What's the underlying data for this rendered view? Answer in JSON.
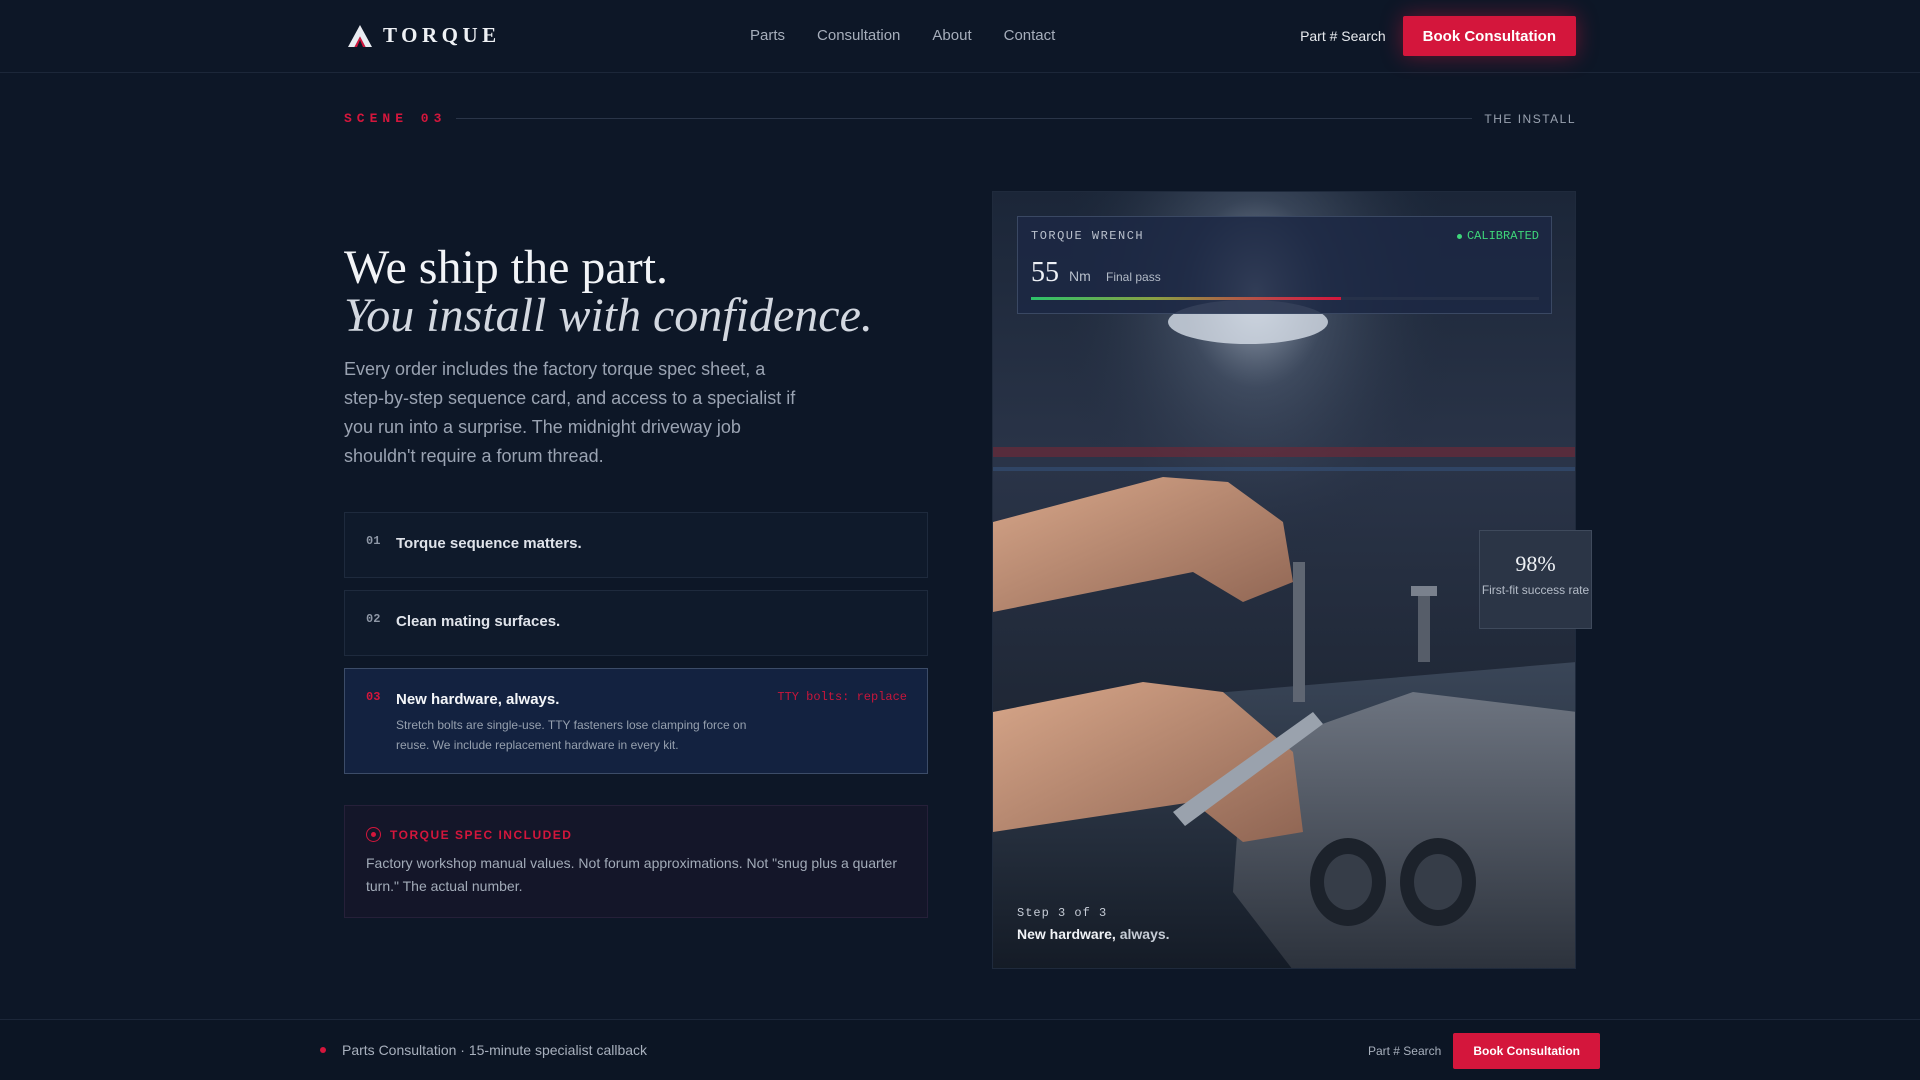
{
  "header": {
    "brand_name": "TORQUE",
    "brand_logo_icon": "triangle-a-logo-icon",
    "nav": [
      {
        "label": "Parts"
      },
      {
        "label": "Consultation"
      },
      {
        "label": "About"
      },
      {
        "label": "Contact"
      }
    ],
    "part_search": "Part # Search",
    "cta": "Book Consultation"
  },
  "scene": {
    "label": "SCENE 03",
    "title": "THE INSTALL"
  },
  "hero": {
    "line1": "We ship the part.",
    "line2": "You install with confidence.",
    "intro": "Every order includes the factory torque spec sheet, a step-by-step sequence card, and access to a specialist if you run into a surprise. The midnight driveway job shouldn't require a forum thread."
  },
  "steps": [
    {
      "num": "01",
      "title": "Torque sequence matters.",
      "desc": "",
      "tag": ""
    },
    {
      "num": "02",
      "title": "Clean mating surfaces.",
      "desc": "",
      "tag": ""
    },
    {
      "num": "03",
      "title": "New hardware, always.",
      "desc": "Stretch bolts are single-use. TTY fasteners lose clamping force on reuse. We include replacement hardware in every kit.",
      "tag": "TTY bolts: replace"
    }
  ],
  "spec_box": {
    "title": "TORQUE SPEC INCLUDED",
    "text": "Factory workshop manual values. Not forum approximations. Not \"snug plus a quarter turn.\" The actual number."
  },
  "wrench_card": {
    "label": "TORQUE WRENCH",
    "status": "CALIBRATED",
    "value": "55",
    "unit": "Nm",
    "note": "Final pass",
    "progress_fraction": 0.61
  },
  "stat": {
    "value": "98%",
    "label": "First-fit success rate"
  },
  "caption": {
    "step": "Step 3 of 3",
    "title_bold": "New hardware,",
    "title_rest": " always."
  },
  "footer": {
    "text": "Parts Consultation · 15-minute specialist callback",
    "part_search": "Part # Search",
    "cta": "Book Consultation"
  },
  "colors": {
    "accent": "#d4163c",
    "background": "#0d1727",
    "success": "#3ed67a"
  }
}
